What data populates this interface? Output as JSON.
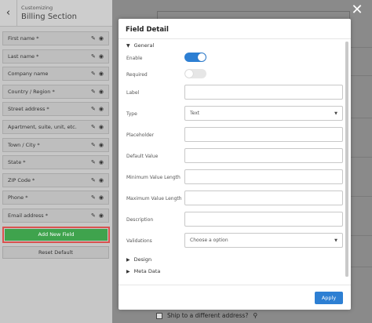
{
  "sidebar": {
    "subtitle": "Customizing",
    "title": "Billing Section",
    "fields": [
      {
        "label": "First name *"
      },
      {
        "label": "Last name *"
      },
      {
        "label": "Company name"
      },
      {
        "label": "Country / Region *"
      },
      {
        "label": "Street address *"
      },
      {
        "label": "Apartment, suite, unit, etc."
      },
      {
        "label": "Town / City *"
      },
      {
        "label": "State *"
      },
      {
        "label": "ZIP Code *"
      },
      {
        "label": "Phone *"
      },
      {
        "label": "Email address *"
      }
    ],
    "add_label": "Add New Field",
    "reset_label": "Reset Default"
  },
  "modal": {
    "title": "Field Detail",
    "general_label": "General",
    "enable_label": "Enable",
    "enable_on": true,
    "required_label": "Required",
    "required_on": false,
    "label_label": "Label",
    "label_value": "",
    "type_label": "Type",
    "type_value": "Text",
    "placeholder_label": "Placeholder",
    "placeholder_value": "",
    "default_label": "Default Value",
    "default_value": "",
    "min_label": "Minimum Value Length",
    "min_value": "",
    "max_label": "Maximum Value Length",
    "max_value": "",
    "description_label": "Description",
    "description_value": "",
    "validations_label": "Validations",
    "validations_placeholder": "Choose a option",
    "design_label": "Design",
    "meta_label": "Meta Data",
    "apply_label": "Apply"
  },
  "page": {
    "ship_label": "Ship to a different address?"
  },
  "colors": {
    "accent": "#2d7fd3",
    "add_button": "#3fa34d",
    "highlight": "#d9534f"
  }
}
